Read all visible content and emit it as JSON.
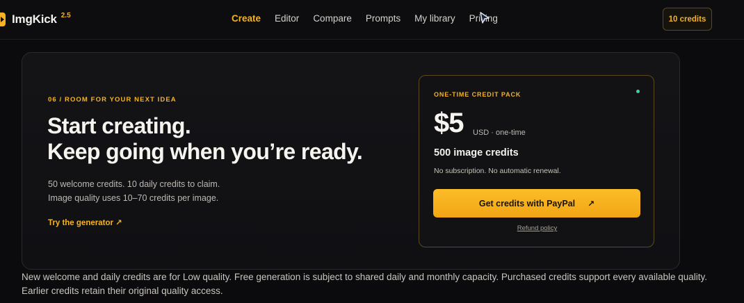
{
  "header": {
    "brand": "ImgKick",
    "version": "2.5",
    "nav": [
      "Create",
      "Editor",
      "Compare",
      "Prompts",
      "My library",
      "Pricing"
    ],
    "active_nav": "Create",
    "credits_button": "10 credits"
  },
  "hero": {
    "eyebrow": "06 / ROOM FOR YOUR NEXT IDEA",
    "headline_line1": "Start creating.",
    "headline_line2": "Keep going when you’re ready.",
    "desc_line1": "50 welcome credits. 10 daily credits to claim.",
    "desc_line2": "Image quality uses 10–70 credits per image.",
    "try_link": "Try the generator ↗"
  },
  "pack": {
    "label": "ONE-TIME CREDIT PACK",
    "price": "$5",
    "unit": "USD · one-time",
    "credits": "500 image credits",
    "note": "No subscription. No automatic renewal.",
    "button": "Get credits with PayPal",
    "button_icon": "↗",
    "refund": "Refund policy",
    "status_color": "#3ad59a"
  },
  "footer": {
    "note": "New welcome and daily credits are for Low quality. Free generation is subject to shared daily and monthly capacity. Purchased credits support every available quality. Earlier credits retain their original quality access."
  },
  "colors": {
    "accent": "#f5b324",
    "background": "#0b0b0d"
  }
}
